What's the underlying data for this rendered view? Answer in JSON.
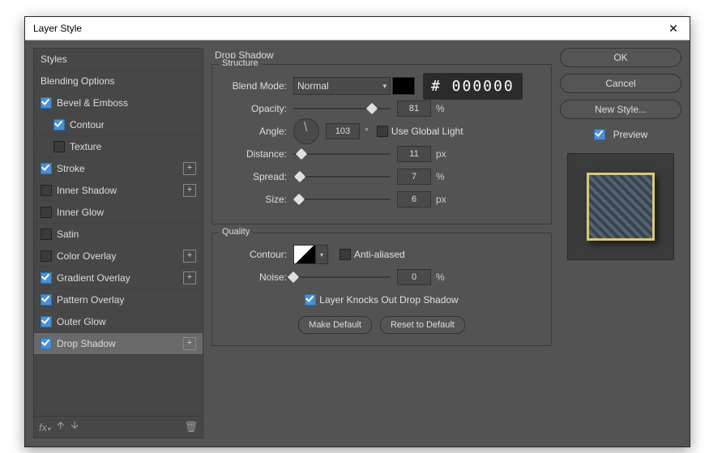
{
  "dialog": {
    "title": "Layer Style"
  },
  "sidebar": {
    "styles_header": "Styles",
    "blending_options": "Blending Options",
    "items": [
      {
        "label": "Bevel & Emboss",
        "checked": true,
        "plus": false,
        "indent": 0
      },
      {
        "label": "Contour",
        "checked": true,
        "plus": false,
        "indent": 1
      },
      {
        "label": "Texture",
        "checked": false,
        "plus": false,
        "indent": 1
      },
      {
        "label": "Stroke",
        "checked": true,
        "plus": true,
        "indent": 0
      },
      {
        "label": "Inner Shadow",
        "checked": false,
        "plus": true,
        "indent": 0
      },
      {
        "label": "Inner Glow",
        "checked": false,
        "plus": false,
        "indent": 0
      },
      {
        "label": "Satin",
        "checked": false,
        "plus": false,
        "indent": 0
      },
      {
        "label": "Color Overlay",
        "checked": false,
        "plus": true,
        "indent": 0
      },
      {
        "label": "Gradient Overlay",
        "checked": true,
        "plus": true,
        "indent": 0
      },
      {
        "label": "Pattern Overlay",
        "checked": true,
        "plus": false,
        "indent": 0
      },
      {
        "label": "Outer Glow",
        "checked": true,
        "plus": false,
        "indent": 0
      },
      {
        "label": "Drop Shadow",
        "checked": true,
        "plus": true,
        "indent": 0,
        "selected": true
      }
    ]
  },
  "panel": {
    "title": "Drop Shadow",
    "structure_legend": "Structure",
    "quality_legend": "Quality",
    "labels": {
      "blend_mode": "Blend Mode:",
      "opacity": "Opacity:",
      "angle": "Angle:",
      "distance": "Distance:",
      "spread": "Spread:",
      "size": "Size:",
      "use_global": "Use Global Light",
      "contour": "Contour:",
      "anti_aliased": "Anti-aliased",
      "noise": "Noise:",
      "knocks_out": "Layer Knocks Out Drop Shadow",
      "make_default": "Make Default",
      "reset_default": "Reset to Default"
    },
    "values": {
      "blend_mode": "Normal",
      "color_hex": "# 000000",
      "opacity": "81",
      "opacity_unit": "%",
      "opacity_pct": 81,
      "angle": "103",
      "angle_unit": "°",
      "use_global": false,
      "distance": "11",
      "distance_unit": "px",
      "distance_pct": 8,
      "spread": "7",
      "spread_unit": "%",
      "spread_pct": 7,
      "size": "6",
      "size_unit": "px",
      "size_pct": 6,
      "anti_aliased": false,
      "noise": "0",
      "noise_unit": "%",
      "noise_pct": 0,
      "knocks_out": true
    }
  },
  "buttons": {
    "ok": "OK",
    "cancel": "Cancel",
    "new_style": "New Style...",
    "preview": "Preview"
  },
  "preview_checked": true
}
